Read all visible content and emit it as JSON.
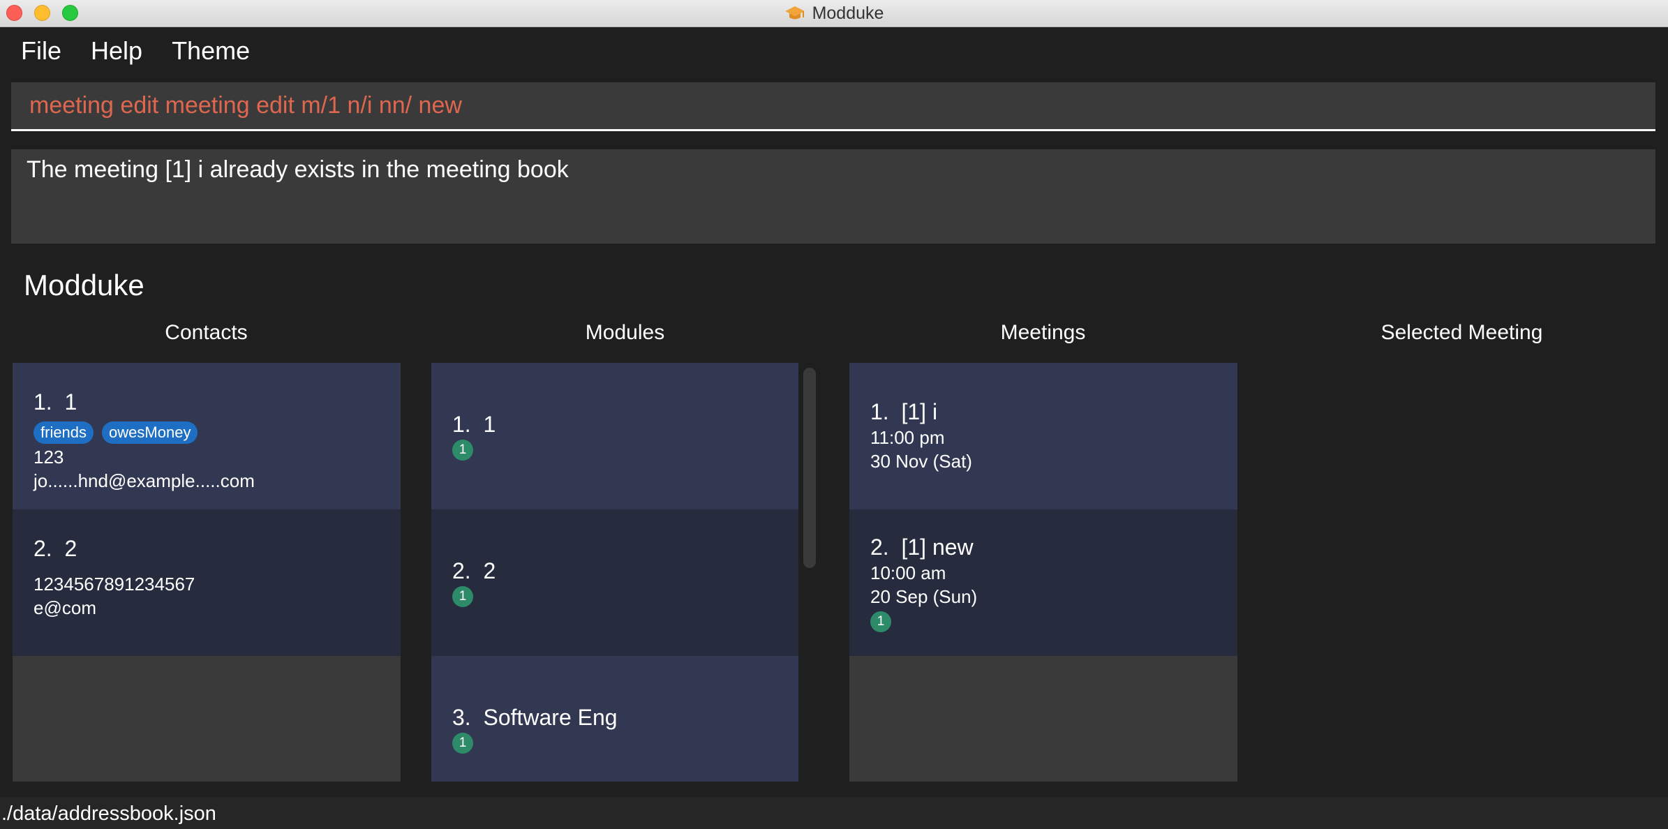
{
  "window": {
    "title": "Modduke"
  },
  "menu": [
    "File",
    "Help",
    "Theme"
  ],
  "command": {
    "value": "meeting edit meeting edit m/1 n/i nn/ new"
  },
  "result": {
    "message": "The meeting [1] i already exists in the meeting book"
  },
  "app_heading": "Modduke",
  "columns": {
    "contacts": "Contacts",
    "modules": "Modules",
    "meetings": "Meetings",
    "selected_meeting": "Selected Meeting"
  },
  "contacts": [
    {
      "index": "1.",
      "name": "1",
      "tags": [
        "friends",
        "owesMoney"
      ],
      "phone": "123",
      "email": "jo......hnd@example.....com"
    },
    {
      "index": "2.",
      "name": "2",
      "phone": "1234567891234567",
      "email": "e@com"
    }
  ],
  "modules": [
    {
      "index": "1.",
      "name": "1",
      "badge": "1"
    },
    {
      "index": "2.",
      "name": "2",
      "badge": "1"
    },
    {
      "index": "3.",
      "name": "Software Eng",
      "badge": "1"
    }
  ],
  "meetings": [
    {
      "index": "1.",
      "name": "[1] i",
      "time": "11:00 pm",
      "date": "30 Nov (Sat)"
    },
    {
      "index": "2.",
      "name": "[1] new",
      "time": "10:00 am",
      "date": "20 Sep (Sun)",
      "badge": "1"
    }
  ],
  "status": {
    "path": "./data/addressbook.json"
  },
  "colors": {
    "command_text": "#e0674f",
    "tag": "#1e6fc4",
    "badge": "#2e8b6a",
    "card_odd": "#333852",
    "card_even": "#262b3e"
  },
  "icons": {
    "title": "graduation-cap-icon"
  }
}
